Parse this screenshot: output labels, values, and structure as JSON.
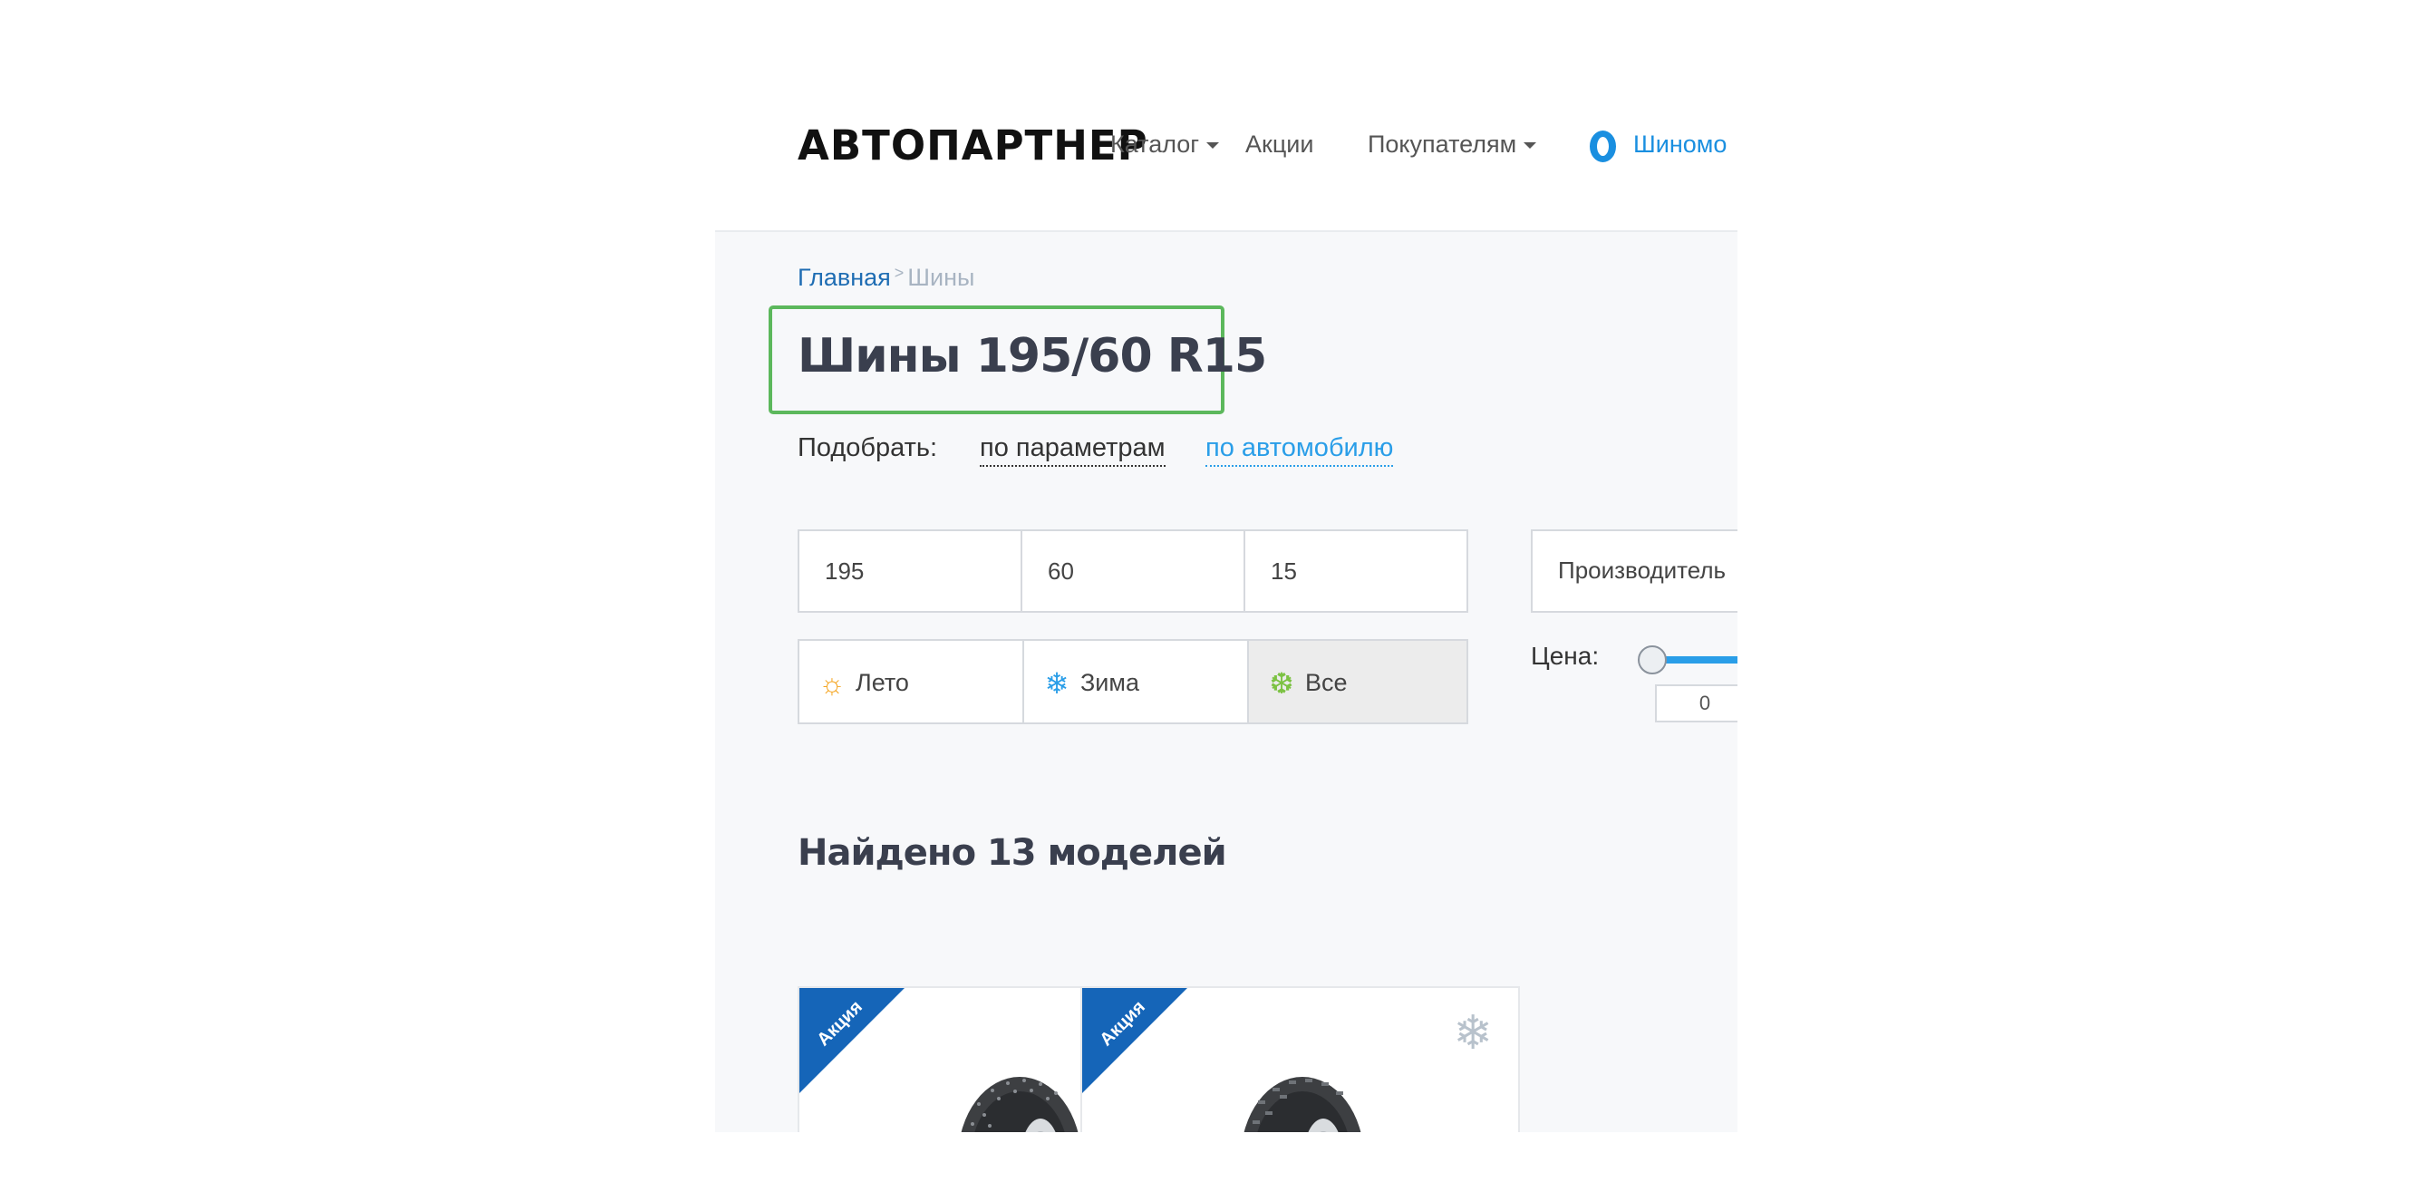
{
  "header": {
    "logo": "АВТОПАРТНЕР",
    "nav": {
      "catalog": "Каталог",
      "promotions": "Акции",
      "customers": "Покупателям",
      "tire_fitting": "Шиномо"
    }
  },
  "breadcrumb": {
    "home": "Главная",
    "separator": ">",
    "current": "Шины"
  },
  "page": {
    "title": "Шины 195/60 R15"
  },
  "selector": {
    "label": "Подобрать:",
    "by_params": "по параметрам",
    "by_car": "по автомобилю"
  },
  "filters": {
    "width": "195",
    "profile": "60",
    "diameter": "15",
    "manufacturer_placeholder": "Производитель",
    "seasons": {
      "summer": "Лето",
      "winter": "Зима",
      "all": "Все"
    },
    "selected_season": "Все",
    "price_label": "Цена:",
    "price_min": "0"
  },
  "results": {
    "found_text": "Найдено 13 моделей"
  },
  "cards": [
    {
      "badge": "Акция",
      "season_icon": "snowflake-icon"
    },
    {
      "badge": "Акция",
      "season_icon": "snowflake-icon"
    }
  ],
  "colors": {
    "accent": "#2a9ee8",
    "link_dark": "#1f6db3",
    "badge": "#1565b8",
    "highlight_box": "#5cb85c",
    "summer_icon": "#f5a623",
    "winter_icon": "#2a9ee8",
    "all_season_icon": "#7cc243"
  }
}
